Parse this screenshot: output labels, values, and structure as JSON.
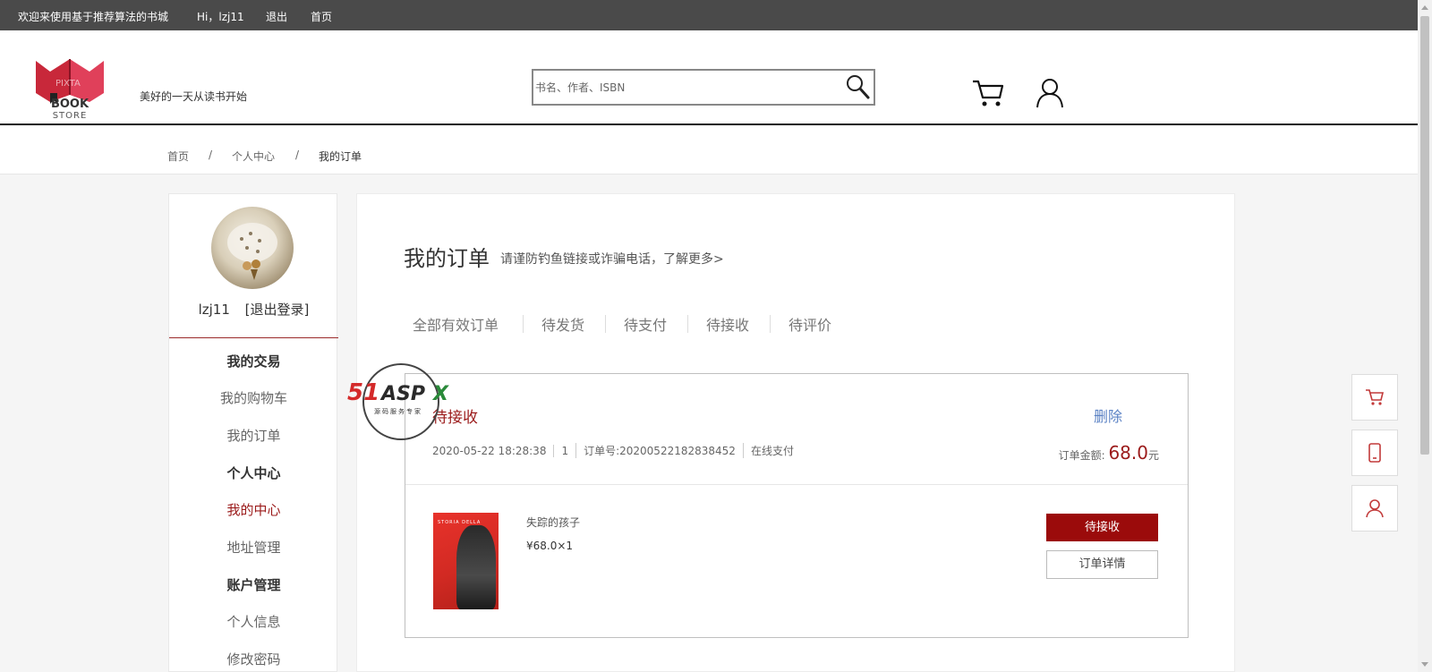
{
  "topbar": {
    "welcome": "欢迎来使用基于推荐算法的书城",
    "greeting": "Hi，lzj11",
    "logout": "退出",
    "home": "首页"
  },
  "header": {
    "logo_line1": "BOOK",
    "logo_line2": "STORE",
    "logo_watermark": "PIXTA",
    "slogan": "美好的一天从读书开始",
    "search_placeholder": "书名、作者、ISBN"
  },
  "breadcrumb": {
    "items": [
      "首页",
      "个人中心",
      "我的订单"
    ],
    "separator": "/"
  },
  "sidebar": {
    "username": "lzj11",
    "logout_link": "[退出登录]",
    "sections": [
      {
        "title": "我的交易",
        "items": [
          "我的购物车",
          "我的订单"
        ]
      },
      {
        "title": "个人中心",
        "items": [
          "我的中心",
          "地址管理"
        ]
      },
      {
        "title": "账户管理",
        "items": [
          "个人信息",
          "修改密码"
        ]
      }
    ]
  },
  "main": {
    "title": "我的订单",
    "note": "请谨防钓鱼链接或诈骗电话，了解更多>",
    "tabs": [
      "全部有效订单",
      "待发货",
      "待支付",
      "待接收",
      "待评价"
    ]
  },
  "order": {
    "status": "待接收",
    "delete_label": "删除",
    "datetime": "2020-05-22 18:28:38",
    "count": "1",
    "order_no": "订单号:20200522182838452",
    "payment": "在线支付",
    "amount_label": "订单金额:",
    "amount_value": "68.0",
    "amount_unit": "元",
    "book_name": "失踪的孩子",
    "book_price": "¥68.0×1",
    "primary_button": "待接收",
    "detail_button": "订单详情"
  },
  "watermark": {
    "brand": "51ASPX",
    "tagline": "源码服务专家"
  },
  "colors": {
    "topbar": "#4a4a4a",
    "accent": "#9b0b0b",
    "link": "#5b82c4"
  },
  "float_buttons": [
    "cart-icon",
    "phone-icon",
    "user-icon"
  ]
}
